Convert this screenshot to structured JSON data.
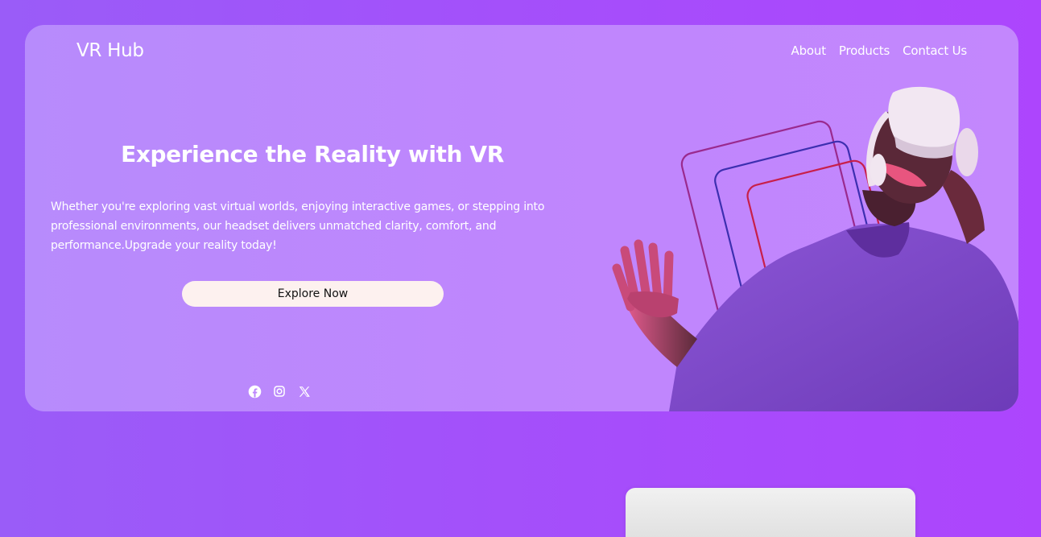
{
  "brand": {
    "name": "VR Hub"
  },
  "nav": {
    "items": [
      {
        "label": "About"
      },
      {
        "label": "Products"
      },
      {
        "label": "Contact Us"
      }
    ]
  },
  "hero": {
    "headline": "Experience the Reality with VR",
    "description": "Whether you're exploring vast virtual worlds, enjoying interactive games, or stepping into professional environments, our headset delivers unmatched clarity, comfort, and performance.Upgrade your reality today!",
    "cta_label": "Explore Now",
    "image_icon": "vr-person-photo"
  },
  "socials": {
    "items": [
      {
        "icon": "facebook-icon"
      },
      {
        "icon": "instagram-icon"
      },
      {
        "icon": "x-icon"
      }
    ]
  },
  "colors": {
    "page_background": "#a352fb",
    "hero_background": "#bd88fd",
    "cta_background": "#fdf1ef",
    "text": "#ffffff"
  }
}
